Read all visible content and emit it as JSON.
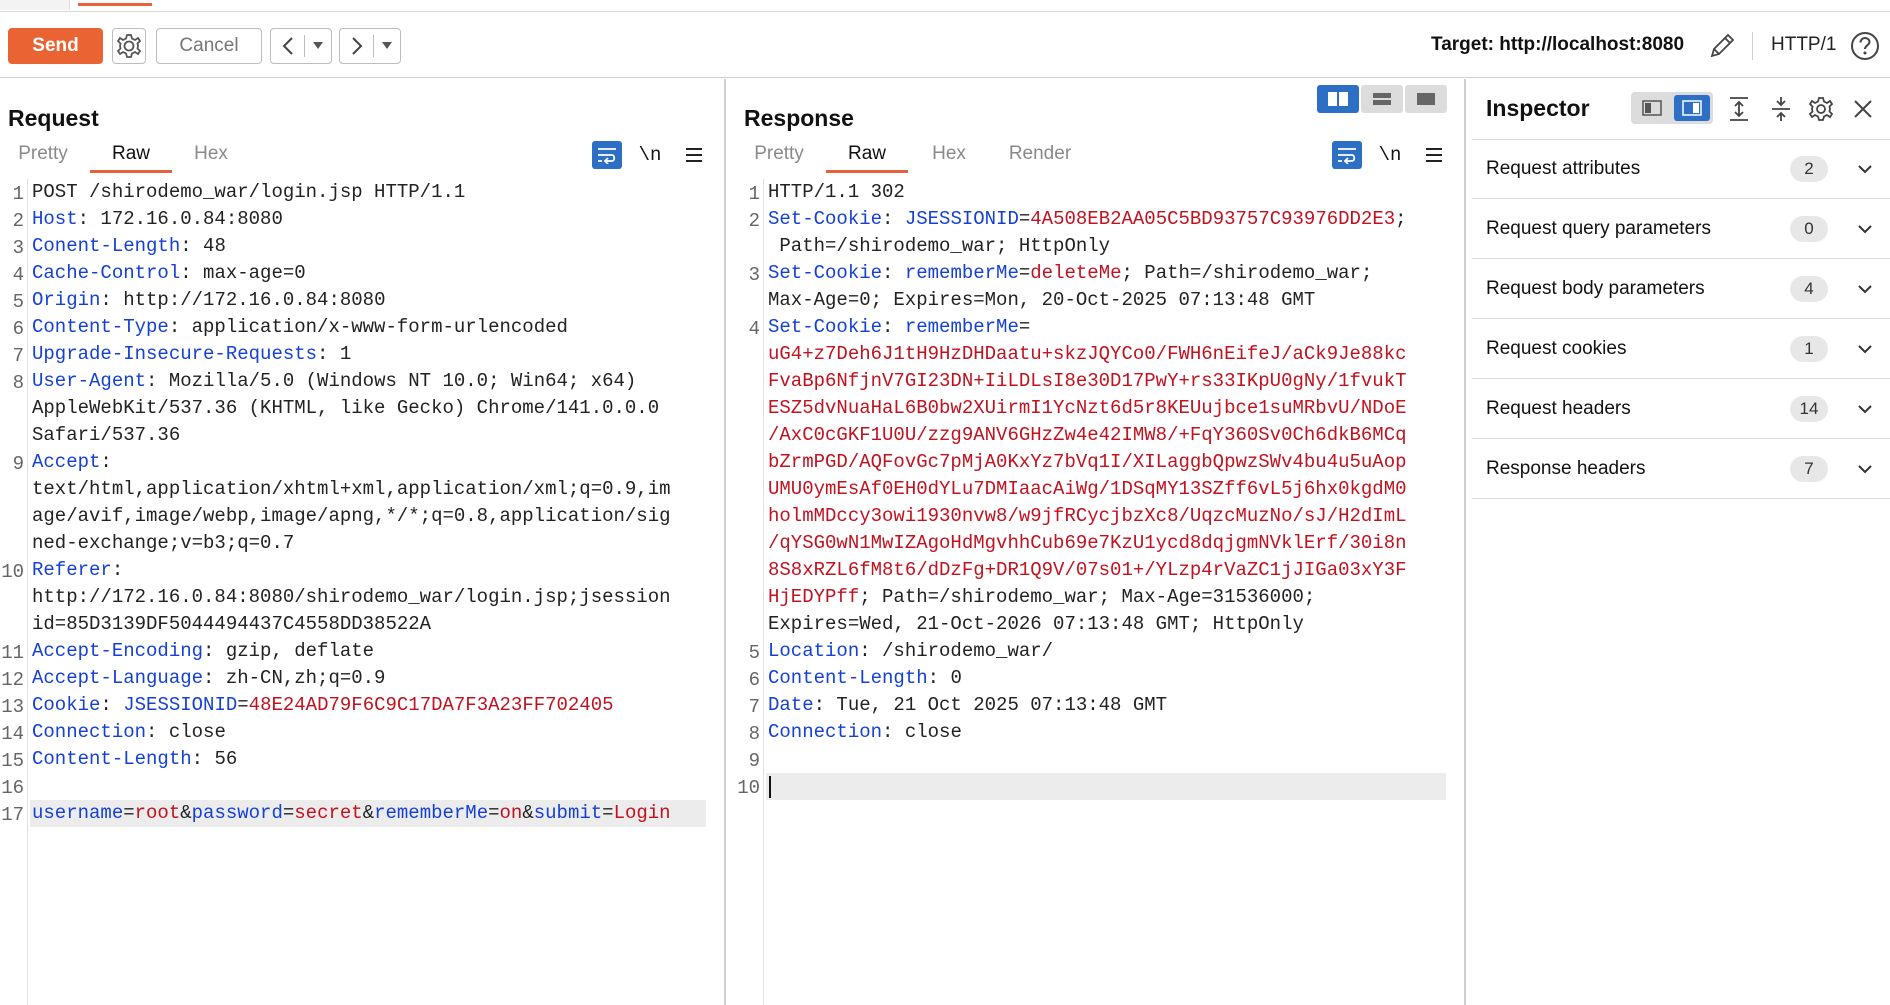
{
  "toolbar": {
    "send_label": "Send",
    "cancel_label": "Cancel",
    "target_prefix": "Target:",
    "target_url": "http://localhost:8080",
    "http_version": "HTTP/1"
  },
  "request": {
    "title": "Request",
    "tabs": [
      "Pretty",
      "Raw",
      "Hex"
    ],
    "active_tab": "Raw",
    "newline_label": "\\n"
  },
  "response": {
    "title": "Response",
    "tabs": [
      "Pretty",
      "Raw",
      "Hex",
      "Render"
    ],
    "active_tab": "Raw",
    "newline_label": "\\n"
  },
  "request_lines": [
    {
      "n": "1",
      "rows": [
        [
          [
            "t",
            "POST /shirodemo_war/login.jsp HTTP/1.1"
          ]
        ]
      ]
    },
    {
      "n": "2",
      "rows": [
        [
          [
            "k",
            "Host"
          ],
          [
            "t",
            ": 172.16.0.84:8080"
          ]
        ]
      ]
    },
    {
      "n": "3",
      "rows": [
        [
          [
            "k",
            "Conent-Length"
          ],
          [
            "t",
            ": 48"
          ]
        ]
      ]
    },
    {
      "n": "4",
      "rows": [
        [
          [
            "k",
            "Cache-Control"
          ],
          [
            "t",
            ": max-age=0"
          ]
        ]
      ]
    },
    {
      "n": "5",
      "rows": [
        [
          [
            "k",
            "Origin"
          ],
          [
            "t",
            ": http://172.16.0.84:8080"
          ]
        ]
      ]
    },
    {
      "n": "6",
      "rows": [
        [
          [
            "k",
            "Content-Type"
          ],
          [
            "t",
            ": application/x-www-form-urlencoded"
          ]
        ]
      ]
    },
    {
      "n": "7",
      "rows": [
        [
          [
            "k",
            "Upgrade-Insecure-Requests"
          ],
          [
            "t",
            ": 1"
          ]
        ]
      ]
    },
    {
      "n": "8",
      "rows": [
        [
          [
            "k",
            "User-Agent"
          ],
          [
            "t",
            ": Mozilla/5.0 (Windows NT 10.0; Win64; x64)"
          ]
        ],
        [
          [
            "t",
            "AppleWebKit/537.36 (KHTML, like Gecko) Chrome/141.0.0.0"
          ]
        ],
        [
          [
            "t",
            "Safari/537.36"
          ]
        ]
      ]
    },
    {
      "n": "9",
      "rows": [
        [
          [
            "k",
            "Accept"
          ],
          [
            "t",
            ":"
          ]
        ],
        [
          [
            "t",
            "text/html,application/xhtml+xml,application/xml;q=0.9,im"
          ]
        ],
        [
          [
            "t",
            "age/avif,image/webp,image/apng,*/*;q=0.8,application/sig"
          ]
        ],
        [
          [
            "t",
            "ned-exchange;v=b3;q=0.7"
          ]
        ]
      ]
    },
    {
      "n": "10",
      "rows": [
        [
          [
            "k",
            "Referer"
          ],
          [
            "t",
            ":"
          ]
        ],
        [
          [
            "t",
            "http://172.16.0.84:8080/shirodemo_war/login.jsp;jsession"
          ]
        ],
        [
          [
            "t",
            "id=85D3139DF5044494437C4558DD38522A"
          ]
        ]
      ]
    },
    {
      "n": "11",
      "rows": [
        [
          [
            "k",
            "Accept-Encoding"
          ],
          [
            "t",
            ": gzip, deflate"
          ]
        ]
      ]
    },
    {
      "n": "12",
      "rows": [
        [
          [
            "k",
            "Accept-Language"
          ],
          [
            "t",
            ": zh-CN,zh;q=0.9"
          ]
        ]
      ]
    },
    {
      "n": "13",
      "rows": [
        [
          [
            "k",
            "Cookie"
          ],
          [
            "t",
            ": "
          ],
          [
            "k",
            "JSESSIONID"
          ],
          [
            "t",
            "="
          ],
          [
            "v",
            "48E24AD79F6C9C17DA7F3A23FF702405"
          ]
        ]
      ]
    },
    {
      "n": "14",
      "rows": [
        [
          [
            "k",
            "Connection"
          ],
          [
            "t",
            ": close"
          ]
        ]
      ]
    },
    {
      "n": "15",
      "rows": [
        [
          [
            "k",
            "Content-Length"
          ],
          [
            "t",
            ": 56"
          ]
        ]
      ]
    },
    {
      "n": "16",
      "rows": [
        [
          [
            "t",
            ""
          ]
        ]
      ]
    },
    {
      "n": "17",
      "rows": [
        [
          [
            "k",
            "username"
          ],
          [
            "t",
            "="
          ],
          [
            "v",
            "root"
          ],
          [
            "t",
            "&"
          ],
          [
            "k",
            "password"
          ],
          [
            "t",
            "="
          ],
          [
            "v",
            "secret"
          ],
          [
            "t",
            "&"
          ],
          [
            "k",
            "rememberMe"
          ],
          [
            "t",
            "="
          ],
          [
            "v",
            "on"
          ],
          [
            "t",
            "&"
          ],
          [
            "k",
            "submit"
          ],
          [
            "t",
            "="
          ],
          [
            "v",
            "Login"
          ]
        ]
      ]
    }
  ],
  "response_lines": [
    {
      "n": "1",
      "rows": [
        [
          [
            "t",
            "HTTP/1.1 302"
          ]
        ]
      ]
    },
    {
      "n": "2",
      "rows": [
        [
          [
            "k",
            "Set-Cookie"
          ],
          [
            "t",
            ": "
          ],
          [
            "k",
            "JSESSIONID"
          ],
          [
            "t",
            "="
          ],
          [
            "v",
            "4A508EB2AA05C5BD93757C93976DD2E3"
          ],
          [
            "t",
            ";"
          ]
        ],
        [
          [
            "t",
            " Path=/shirodemo_war; HttpOnly"
          ]
        ]
      ]
    },
    {
      "n": "3",
      "rows": [
        [
          [
            "k",
            "Set-Cookie"
          ],
          [
            "t",
            ": "
          ],
          [
            "k",
            "rememberMe"
          ],
          [
            "t",
            "="
          ],
          [
            "v",
            "deleteMe"
          ],
          [
            "t",
            "; Path=/shirodemo_war;"
          ]
        ],
        [
          [
            "t",
            "Max-Age=0; Expires=Mon, 20-Oct-2025 07:13:48 GMT"
          ]
        ]
      ]
    },
    {
      "n": "4",
      "rows": [
        [
          [
            "k",
            "Set-Cookie"
          ],
          [
            "t",
            ": "
          ],
          [
            "k",
            "rememberMe"
          ],
          [
            "t",
            "="
          ]
        ],
        [
          [
            "v",
            "uG4+z7Deh6J1tH9HzDHDaatu+skzJQYCo0/FWH6nEifeJ/aCk9Je88kc"
          ]
        ],
        [
          [
            "v",
            "FvaBp6NfjnV7GI23DN+IiLDLsI8e30D17PwY+rs33IKpU0gNy/1fvukT"
          ]
        ],
        [
          [
            "v",
            "ESZ5dvNuaHaL6B0bw2XUirmI1YcNzt6d5r8KEUujbce1suMRbvU/NDoE"
          ]
        ],
        [
          [
            "v",
            "/AxC0cGKF1U0U/zzg9ANV6GHzZw4e42IMW8/+FqY360Sv0Ch6dkB6MCq"
          ]
        ],
        [
          [
            "v",
            "bZrmPGD/AQFovGc7pMjA0KxYz7bVq1I/XILaggbQpwzSWv4bu4u5uAop"
          ]
        ],
        [
          [
            "v",
            "UMU0ymEsAf0EH0dYLu7DMIaacAiWg/1DSqMY13SZff6vL5j6hx0kgdM0"
          ]
        ],
        [
          [
            "v",
            "holmMDccy3owi1930nvw8/w9jfRCycjbzXc8/UqzcMuzNo/sJ/H2dImL"
          ]
        ],
        [
          [
            "v",
            "/qYSG0wN1MwIZAgoHdMgvhhCub69e7KzU1ycd8dqjgmNVklErf/30i8n"
          ]
        ],
        [
          [
            "v",
            "8S8xRZL6fM8t6/dDzFg+DR1Q9V/07s01+/YLzp4rVaZC1jJIGa03xY3F"
          ]
        ],
        [
          [
            "v",
            "HjEDYPff"
          ],
          [
            "t",
            "; Path=/shirodemo_war; Max-Age=31536000;"
          ]
        ],
        [
          [
            "t",
            "Expires=Wed, 21-Oct-2026 07:13:48 GMT; HttpOnly"
          ]
        ]
      ]
    },
    {
      "n": "5",
      "rows": [
        [
          [
            "k",
            "Location"
          ],
          [
            "t",
            ": /shirodemo_war/"
          ]
        ]
      ]
    },
    {
      "n": "6",
      "rows": [
        [
          [
            "k",
            "Content-Length"
          ],
          [
            "t",
            ": 0"
          ]
        ]
      ]
    },
    {
      "n": "7",
      "rows": [
        [
          [
            "k",
            "Date"
          ],
          [
            "t",
            ": Tue, 21 Oct 2025 07:13:48 GMT"
          ]
        ]
      ]
    },
    {
      "n": "8",
      "rows": [
        [
          [
            "k",
            "Connection"
          ],
          [
            "t",
            ": close"
          ]
        ]
      ]
    },
    {
      "n": "9",
      "rows": [
        [
          [
            "t",
            ""
          ]
        ]
      ]
    },
    {
      "n": "10",
      "rows": [
        [
          [
            "t",
            ""
          ]
        ]
      ]
    }
  ],
  "inspector": {
    "title": "Inspector",
    "sections": [
      {
        "label": "Request attributes",
        "count": "2"
      },
      {
        "label": "Request query parameters",
        "count": "0"
      },
      {
        "label": "Request body parameters",
        "count": "4"
      },
      {
        "label": "Request cookies",
        "count": "1"
      },
      {
        "label": "Request headers",
        "count": "14"
      },
      {
        "label": "Response headers",
        "count": "7"
      }
    ]
  },
  "colors": {
    "accent": "#ea6333",
    "key": "#1440d6",
    "value": "#c1121f",
    "toggle": "#2c6fc5"
  }
}
